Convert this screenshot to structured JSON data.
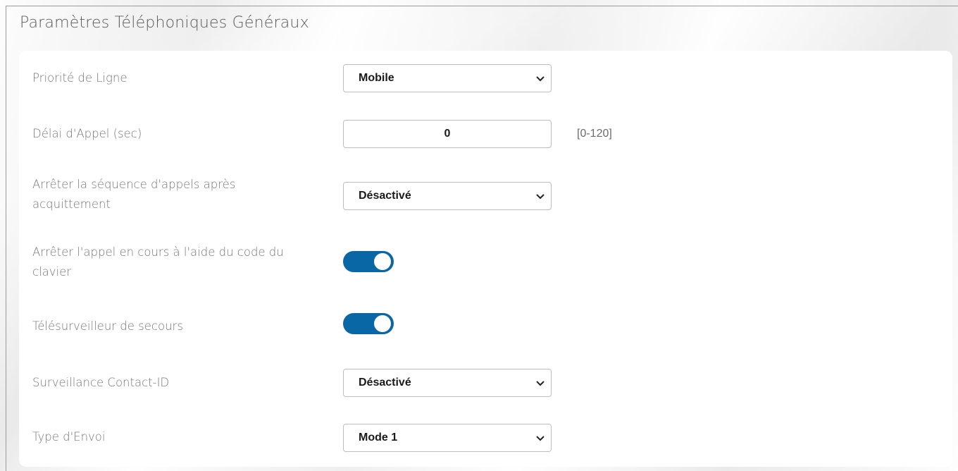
{
  "page": {
    "title": "Paramètres Téléphoniques Généraux"
  },
  "colors": {
    "toggle_on": "#0a67a5",
    "label_text": "#777777"
  },
  "settings": {
    "line_priority": {
      "label": "Priorité de Ligne",
      "value": "Mobile"
    },
    "call_delay": {
      "label": "Délai d'Appel (sec)",
      "value": "0",
      "range": "[0-120]"
    },
    "stop_sequence": {
      "label": "Arrêter la séquence d'appels après acquittement",
      "value": "Désactivé"
    },
    "stop_call_keypad": {
      "label": "Arrêter l'appel en cours à l'aide du code du clavier",
      "enabled": true
    },
    "backup_monitor": {
      "label": "Télésurveilleur de secours",
      "enabled": true
    },
    "contact_id": {
      "label": "Surveillance Contact-ID",
      "value": "Désactivé"
    },
    "send_type": {
      "label": "Type d'Envoi",
      "value": "Mode 1"
    }
  }
}
